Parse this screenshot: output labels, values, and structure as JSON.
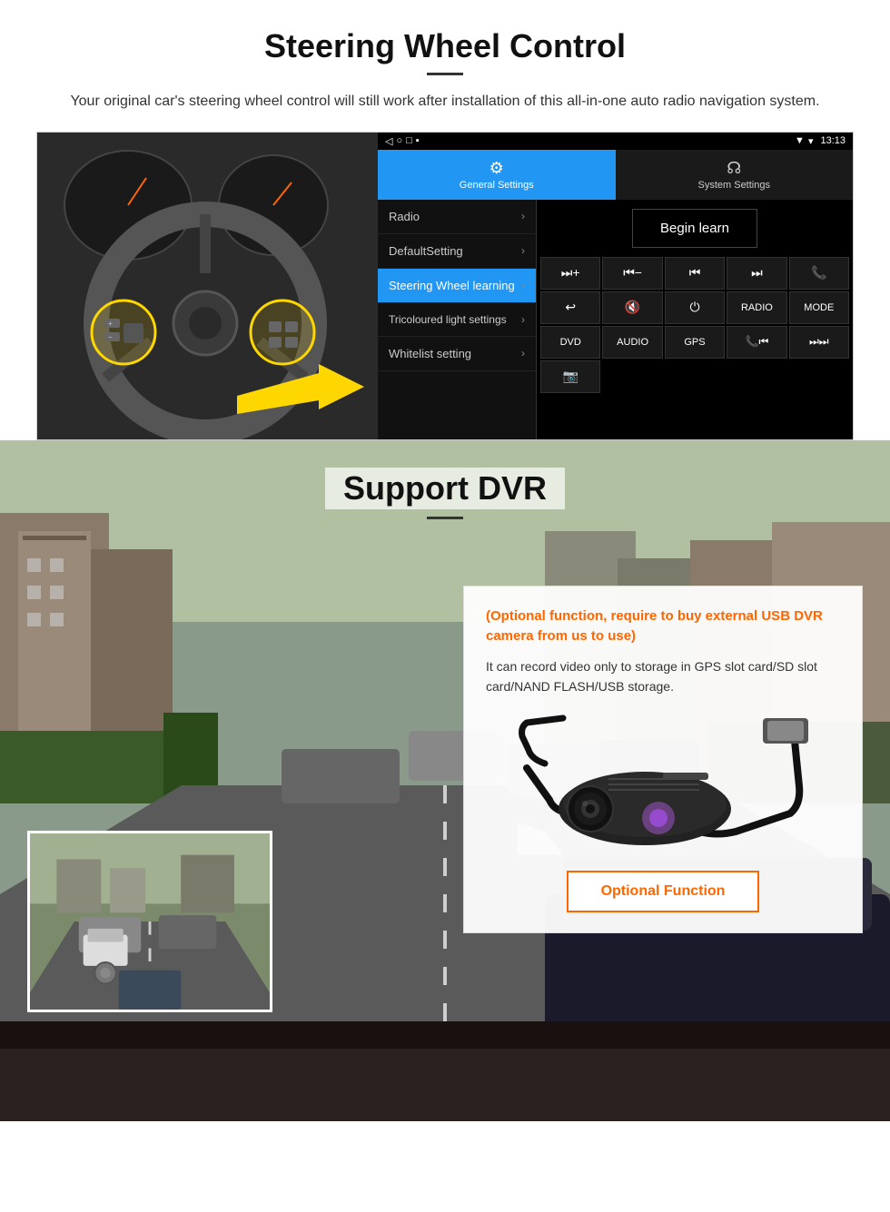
{
  "steering": {
    "title": "Steering Wheel Control",
    "description": "Your original car's steering wheel control will still work after installation of this all-in-one auto radio navigation system.",
    "android": {
      "statusbar": {
        "signal_icon": "▼",
        "wifi_icon": "▾",
        "time": "13:13"
      },
      "navbar": {
        "back": "◁",
        "home": "○",
        "square": "□",
        "menu": "▪"
      },
      "tabs": [
        {
          "icon": "⚙",
          "label": "General Settings",
          "active": true
        },
        {
          "icon": "☊",
          "label": "System Settings",
          "active": false
        }
      ],
      "menu_items": [
        {
          "label": "Radio",
          "active": false
        },
        {
          "label": "DefaultSetting",
          "active": false
        },
        {
          "label": "Steering Wheel learning",
          "active": true
        },
        {
          "label": "Tricoloured light settings",
          "active": false
        },
        {
          "label": "Whitelist setting",
          "active": false
        }
      ],
      "begin_learn": "Begin learn",
      "control_buttons": [
        "⏭+",
        "⏮−",
        "⏮⏮",
        "⏭⏭",
        "📞",
        "↩",
        "🔇x",
        "⏻",
        "RADIO",
        "MODE",
        "DVD",
        "AUDIO",
        "GPS",
        "📞⏮",
        "⏭⏭"
      ]
    }
  },
  "dvr": {
    "title": "Support DVR",
    "optional_text": "(Optional function, require to buy external USB DVR camera from us to use)",
    "description": "It can record video only to storage in GPS slot card/SD slot card/NAND FLASH/USB storage.",
    "button_label": "Optional Function"
  }
}
